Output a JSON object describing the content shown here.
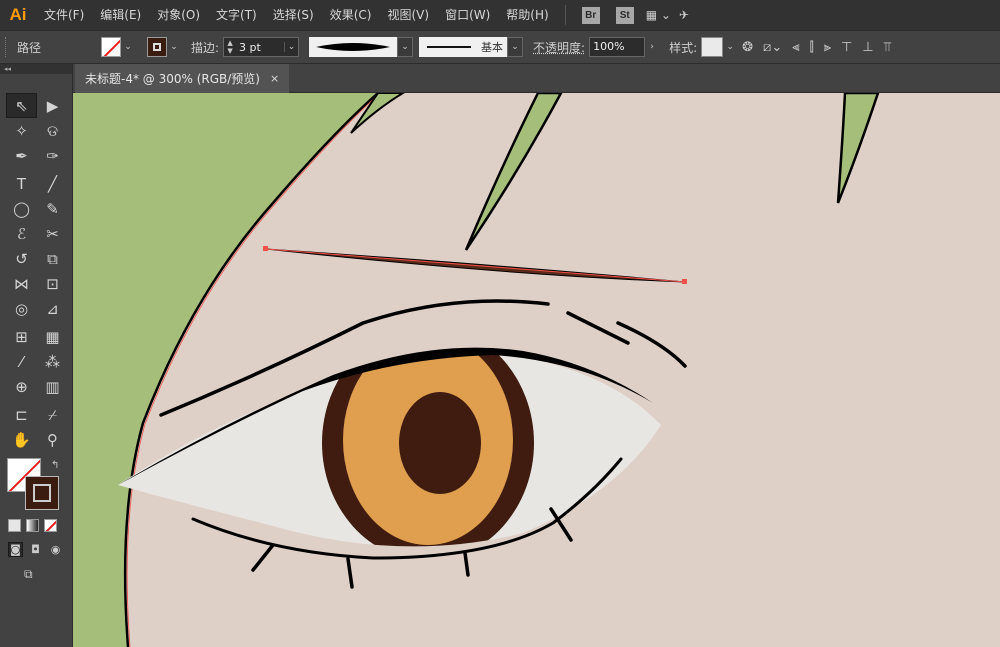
{
  "app": {
    "logo": "Ai"
  },
  "menu": [
    "文件(F)",
    "编辑(E)",
    "对象(O)",
    "文字(T)",
    "选择(S)",
    "效果(C)",
    "视图(V)",
    "窗口(W)",
    "帮助(H)"
  ],
  "app_buttons": [
    "Br",
    "St"
  ],
  "control": {
    "selection_type": "路径",
    "stroke_label": "描边:",
    "stroke_value": "3 pt",
    "brush_label": "基本",
    "opacity_label": "不透明度:",
    "opacity_value": "100%",
    "style_label": "样式:"
  },
  "document": {
    "tab_title": "未标题-4* @ 300% (RGB/预览)",
    "close": "×"
  },
  "toolbox": {
    "collapse": "◂◂",
    "tools": [
      {
        "name": "selection-tool",
        "glyph": "⇖",
        "selected": true
      },
      {
        "name": "direct-selection-tool",
        "glyph": "▶"
      },
      {
        "name": "magic-wand-tool",
        "glyph": "✧"
      },
      {
        "name": "lasso-tool",
        "glyph": "ଡ"
      },
      {
        "name": "pen-tool",
        "glyph": "✒"
      },
      {
        "name": "curvature-tool",
        "glyph": "✑"
      },
      {
        "name": "type-tool",
        "glyph": "T"
      },
      {
        "name": "line-tool",
        "glyph": "╱"
      },
      {
        "name": "ellipse-tool",
        "glyph": "◯"
      },
      {
        "name": "paintbrush-tool",
        "glyph": "✎"
      },
      {
        "name": "shaper-tool",
        "glyph": "ℰ"
      },
      {
        "name": "scissors-tool",
        "glyph": "✂"
      },
      {
        "name": "rotate-tool",
        "glyph": "↺"
      },
      {
        "name": "scale-tool",
        "glyph": "⧉"
      },
      {
        "name": "width-tool",
        "glyph": "⋈"
      },
      {
        "name": "free-transform-tool",
        "glyph": "⊡"
      },
      {
        "name": "shape-builder-tool",
        "glyph": "◎"
      },
      {
        "name": "perspective-grid-tool",
        "glyph": "⊿"
      },
      {
        "name": "mesh-tool",
        "glyph": "⊞"
      },
      {
        "name": "gradient-tool",
        "glyph": "▦"
      },
      {
        "name": "eyedropper-tool",
        "glyph": "⁄"
      },
      {
        "name": "blend-tool",
        "glyph": "⁂"
      },
      {
        "name": "symbol-sprayer-tool",
        "glyph": "⊕"
      },
      {
        "name": "column-graph-tool",
        "glyph": "▥"
      },
      {
        "name": "artboard-tool",
        "glyph": "⊏"
      },
      {
        "name": "slice-tool",
        "glyph": "⌿"
      },
      {
        "name": "hand-tool",
        "glyph": "✋"
      },
      {
        "name": "zoom-tool",
        "glyph": "⚲"
      }
    ]
  },
  "colors": {
    "background": "#dfd0c7",
    "hair": "#a5bf7b",
    "iris_outer": "#3f1c0f",
    "iris_inner": "#df9f4e",
    "pupil": "#3f1c0f",
    "sclera": "#e8e6e3",
    "line": "#000000",
    "brow": "#5a2a1a",
    "selection": "#f0504a"
  }
}
